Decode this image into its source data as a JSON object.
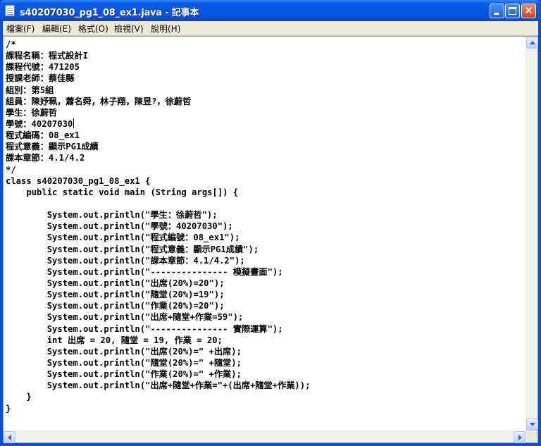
{
  "window": {
    "title": "s40207030_pg1_08_ex1.java - 記事本"
  },
  "menu": [
    "檔案(F)",
    "編輯(E)",
    "格式(O)",
    "檢視(V)",
    "說明(H)"
  ],
  "editor": {
    "lines": [
      "/*",
      "課程名稱：程式設計I",
      "課程代號：471205",
      "授課老師：蔡佳縣",
      "組別：第5組",
      "組員：陳妤珮，蕭名舜，林子翔，陳昱?，徐蔚哲",
      "學生：徐蔚哲",
      "學號：40207030",
      "程式編碼：08_ex1",
      "程式意義：顯示PG1成績",
      "課本章節：4.1/4.2",
      "*/",
      "class s40207030_pg1_08_ex1 {",
      "    public static void main (String args[]) {",
      "",
      "        System.out.println(\"學生：徐蔚哲\");",
      "        System.out.println(\"學號：40207030\");",
      "        System.out.println(\"程式編號：08_ex1\");",
      "        System.out.println(\"程式意義：顯示PG1成績\");",
      "        System.out.println(\"課本章節：4.1/4.2\");",
      "        System.out.println(\"--------------- 模擬畫面\");",
      "        System.out.println(\"出席(20%)=20\");",
      "        System.out.println(\"隨堂(20%)=19\");",
      "        System.out.println(\"作業(20%)=20\");",
      "        System.out.println(\"出席+隨堂+作業=59\");",
      "        System.out.println(\"--------------- 實際運算\");",
      "        int 出席 = 20, 隨堂 = 19, 作業 = 20;",
      "        System.out.println(\"出席(20%)=\" +出席);",
      "        System.out.println(\"隨堂(20%)=\" +隨堂);",
      "        System.out.println(\"作業(20%)=\" +作業);",
      "        System.out.println(\"出席+隨堂+作業=\"+(出席+隨堂+作業));",
      "    }",
      "}"
    ]
  },
  "icons": {
    "app": "notepad-icon",
    "minimize": "minimize-icon",
    "maximize": "maximize-icon",
    "close": "close-icon"
  },
  "colors": {
    "titlebar": "#0a5ae6",
    "close_button": "#c9431f",
    "menubar": "#ece9d8"
  }
}
